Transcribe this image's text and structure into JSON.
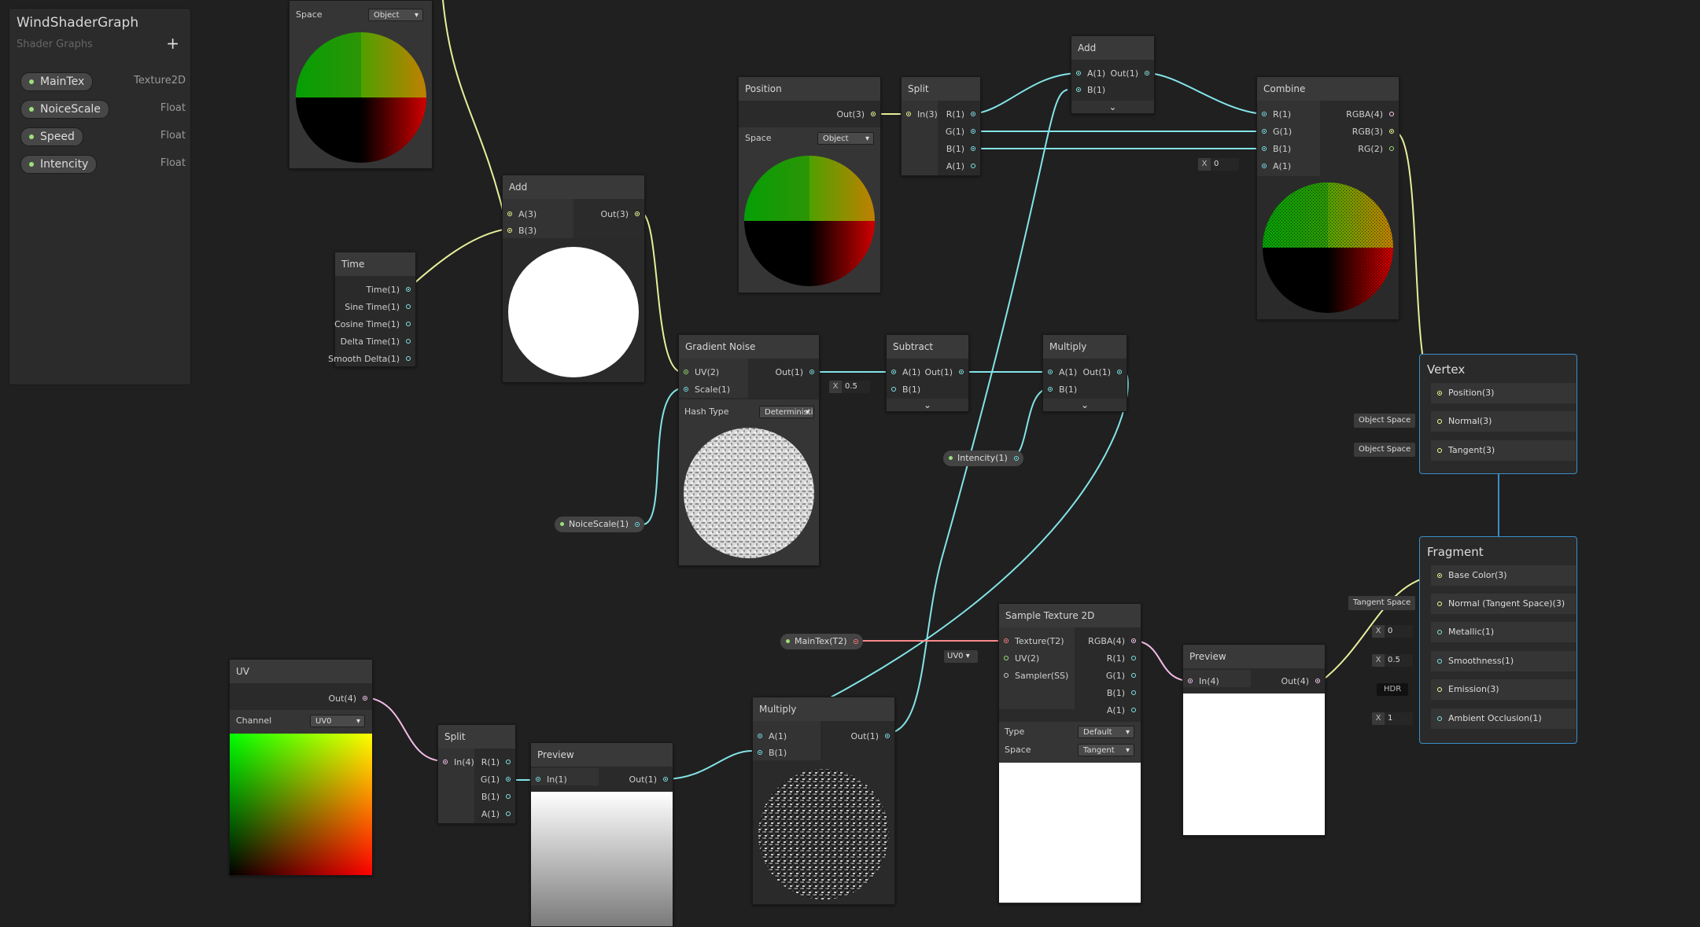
{
  "blackboard": {
    "title": "WindShaderGraph",
    "subtitle": "Shader Graphs",
    "add_label": "+",
    "properties": [
      {
        "name": "MainTex",
        "type": "Texture2D"
      },
      {
        "name": "NoiceScale",
        "type": "Float"
      },
      {
        "name": "Speed",
        "type": "Float"
      },
      {
        "name": "Intencity",
        "type": "Float"
      }
    ]
  },
  "nodes": {
    "position_top": {
      "space_label": "Space",
      "space_value": "Object"
    },
    "add1": {
      "title": "Add",
      "in_a": "A(3)",
      "in_b": "B(3)",
      "out": "Out(3)"
    },
    "time": {
      "title": "Time",
      "outs": [
        "Time(1)",
        "Sine Time(1)",
        "Cosine Time(1)",
        "Delta Time(1)",
        "Smooth Delta(1)"
      ]
    },
    "position": {
      "title": "Position",
      "out": "Out(3)",
      "space_label": "Space",
      "space_value": "Object"
    },
    "split1": {
      "title": "Split",
      "in": "In(3)",
      "outs": [
        "R(1)",
        "G(1)",
        "B(1)",
        "A(1)"
      ]
    },
    "add2": {
      "title": "Add",
      "in_a": "A(1)",
      "in_b": "B(1)",
      "out": "Out(1)"
    },
    "combine": {
      "title": "Combine",
      "ins": [
        "R(1)",
        "G(1)",
        "B(1)",
        "A(1)"
      ],
      "outs": [
        "RGBA(4)",
        "RGB(3)",
        "RG(2)"
      ],
      "a_x": "X",
      "a_value": "0"
    },
    "gradient_noise": {
      "title": "Gradient Noise",
      "in_uv": "UV(2)",
      "in_scale": "Scale(1)",
      "out": "Out(1)",
      "hash_label": "Hash Type",
      "hash_value": "Deterministic"
    },
    "subtract": {
      "title": "Subtract",
      "in_a": "A(1)",
      "in_b": "B(1)",
      "out": "Out(1)",
      "b_x": "X",
      "b_value": "0.5"
    },
    "multiply1": {
      "title": "Multiply",
      "in_a": "A(1)",
      "in_b": "B(1)",
      "out": "Out(1)"
    },
    "intencity_prop": {
      "label": "Intencity(1)"
    },
    "noicescale_prop": {
      "label": "NoiceScale(1)"
    },
    "maintex_prop": {
      "label": "MainTex(T2)"
    },
    "uv": {
      "title": "UV",
      "out": "Out(4)",
      "channel_label": "Channel",
      "channel_value": "UV0"
    },
    "split2": {
      "title": "Split",
      "in": "In(4)",
      "outs": [
        "R(1)",
        "G(1)",
        "B(1)",
        "A(1)"
      ]
    },
    "preview1": {
      "title": "Preview",
      "in": "In(1)",
      "out": "Out(1)"
    },
    "multiply2": {
      "title": "Multiply",
      "in_a": "A(1)",
      "in_b": "B(1)",
      "out": "Out(1)"
    },
    "sample_texture": {
      "title": "Sample Texture 2D",
      "ins": [
        "Texture(T2)",
        "UV(2)",
        "Sampler(SS)"
      ],
      "outs": [
        "RGBA(4)",
        "R(1)",
        "G(1)",
        "B(1)",
        "A(1)"
      ],
      "type_label": "Type",
      "type_value": "Default",
      "space_label": "Space",
      "space_value": "Tangent",
      "uv_value": "UV0"
    },
    "preview2": {
      "title": "Preview",
      "in": "In(4)",
      "out": "Out(4)"
    }
  },
  "vertex": {
    "title": "Vertex",
    "slots": [
      "Position(3)",
      "Normal(3)",
      "Tangent(3)"
    ],
    "normal_tag": "Object Space",
    "tangent_tag": "Object Space"
  },
  "fragment": {
    "title": "Fragment",
    "slots": [
      "Base Color(3)",
      "Normal (Tangent Space)(3)",
      "Metallic(1)",
      "Smoothness(1)",
      "Emission(3)",
      "Ambient Occlusion(1)"
    ],
    "normal_tag": "Tangent Space",
    "metallic_x": "X",
    "metallic_value": "0",
    "smoothness_x": "X",
    "smoothness_value": "0.5",
    "emission_tag": "HDR",
    "ao_x": "X",
    "ao_value": "1"
  },
  "colors": {
    "vector1": "#84e4e7",
    "vector3": "#f6ff9a",
    "vector4": "#fbcbf4",
    "texture": "#ff8b8b",
    "master_border": "#3a8ec7"
  }
}
